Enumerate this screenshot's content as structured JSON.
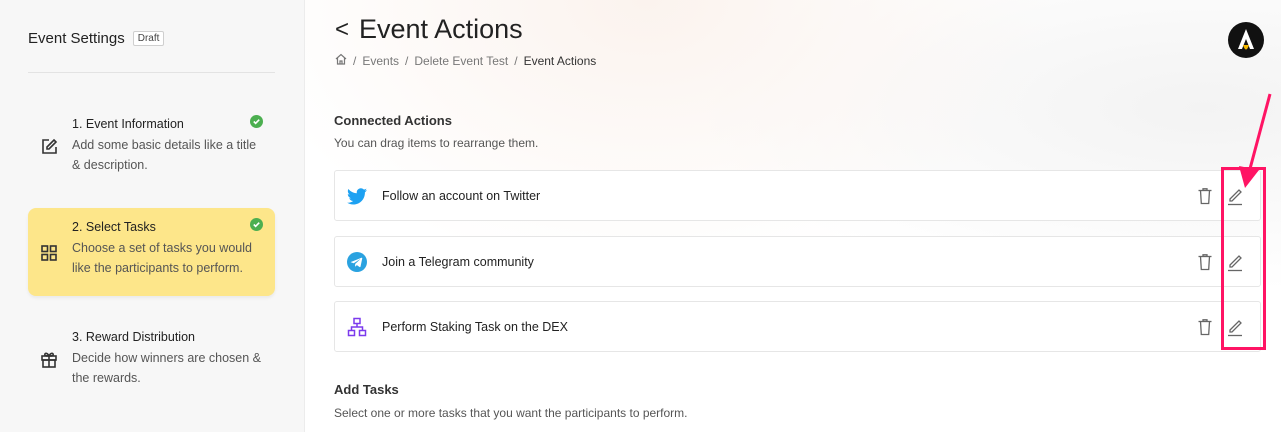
{
  "sidebar": {
    "title": "Event Settings",
    "badge": "Draft",
    "steps": [
      {
        "title": "1. Event Information",
        "desc": "Add some basic details like a title & description.",
        "icon": "edit-icon",
        "complete": true
      },
      {
        "title": "2. Select Tasks",
        "desc": "Choose a set of tasks you would like the participants to perform.",
        "icon": "grid-icon",
        "complete": true,
        "active": true
      },
      {
        "title": "3. Reward Distribution",
        "desc": "Decide how winners are chosen & the rewards.",
        "icon": "gift-icon",
        "complete": false
      }
    ]
  },
  "header": {
    "back": "<",
    "title": "Event Actions",
    "breadcrumb": [
      "Events",
      "Delete Event Test",
      "Event Actions"
    ],
    "avatar_letter": "A"
  },
  "connected": {
    "title": "Connected Actions",
    "subtitle": "You can drag items to rearrange them.",
    "items": [
      {
        "label": "Follow an account on Twitter",
        "icon": "twitter-icon"
      },
      {
        "label": "Join a Telegram community",
        "icon": "telegram-icon"
      },
      {
        "label": "Perform Staking Task on the DEX",
        "icon": "network-icon"
      }
    ]
  },
  "add_tasks": {
    "title": "Add Tasks",
    "subtitle": "Select one or more tasks that you want the participants to perform."
  },
  "colors": {
    "active_step": "#fde68a",
    "check": "#4caf50",
    "twitter": "#1da1f2",
    "telegram": "#2aa2e0",
    "network": "#7c3aed",
    "annotation": "#ff1464"
  }
}
